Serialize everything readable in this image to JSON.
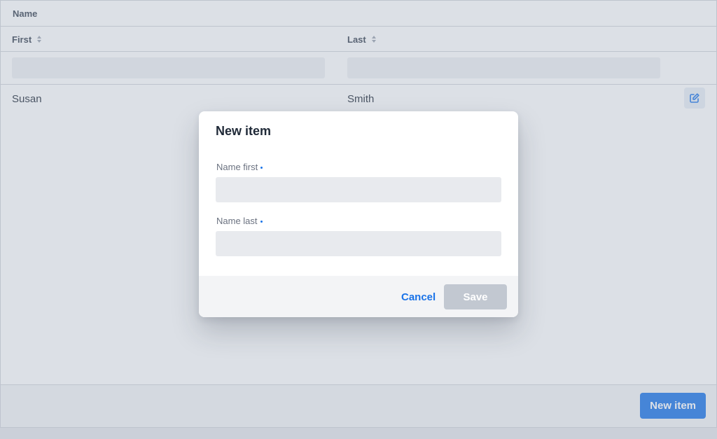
{
  "table": {
    "group_header": "Name",
    "columns": [
      {
        "label": "First"
      },
      {
        "label": "Last"
      }
    ],
    "rows": [
      {
        "first": "Susan",
        "last": "Smith"
      }
    ]
  },
  "footer": {
    "new_item_label": "New item"
  },
  "dialog": {
    "title": "New item",
    "fields": [
      {
        "label": "Name first",
        "value": ""
      },
      {
        "label": "Name last",
        "value": ""
      }
    ],
    "cancel_label": "Cancel",
    "save_label": "Save"
  },
  "icons": {
    "sort": "sort-icon",
    "edit": "edit-icon"
  },
  "colors": {
    "accent": "#1a73e8",
    "disabled_button": "#c2c8d1"
  }
}
